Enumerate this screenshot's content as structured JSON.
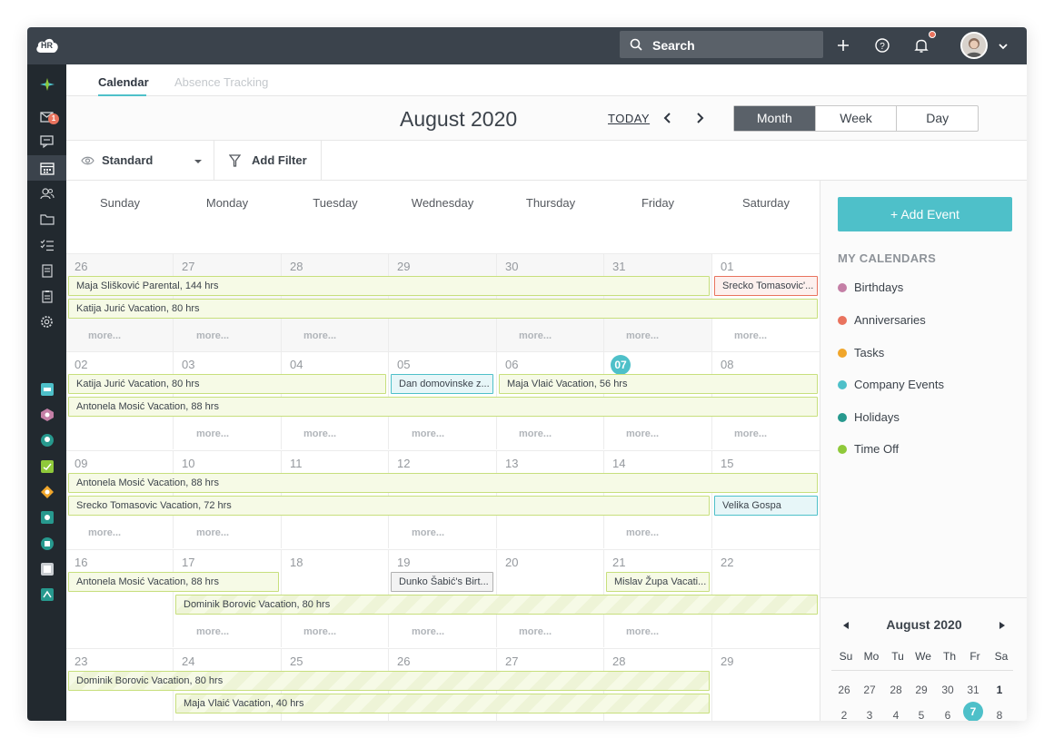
{
  "topbar": {
    "logo_text": "HR",
    "search_label": "Search",
    "notification_dot_color": "#e9735e"
  },
  "sidebar": {
    "inbox_badge": "1",
    "accent_color": "#4ec0c9"
  },
  "tabs": [
    {
      "label": "Calendar",
      "active": true
    },
    {
      "label": "Absence Tracking",
      "active": false
    }
  ],
  "header": {
    "month_title": "August 2020",
    "today_label": "TODAY",
    "views": [
      {
        "label": "Month",
        "active": true
      },
      {
        "label": "Week",
        "active": false
      },
      {
        "label": "Day",
        "active": false
      }
    ]
  },
  "filters": {
    "standard_label": "Standard",
    "add_filter_label": "Add Filter"
  },
  "calendar": {
    "day_names": [
      "Sunday",
      "Monday",
      "Tuesday",
      "Wednesday",
      "Thursday",
      "Friday",
      "Saturday"
    ],
    "more_label": "more...",
    "weeks": [
      {
        "days": [
          "26",
          "27",
          "28",
          "29",
          "30",
          "31",
          "01"
        ],
        "events": [
          {
            "label": "Maja Slišković Parental, 144 hrs",
            "type": "to"
          },
          {
            "label": "Srecko Tomasovic'...",
            "type": "an"
          },
          {
            "label": "Katija Jurić Vacation, 80 hrs",
            "type": "to"
          }
        ]
      },
      {
        "days": [
          "02",
          "03",
          "04",
          "05",
          "06",
          "07",
          "08"
        ],
        "events": [
          {
            "label": "Katija Jurić Vacation, 80 hrs",
            "type": "to"
          },
          {
            "label": "Dan domovinske z...",
            "type": "co"
          },
          {
            "label": "Maja Vlaić Vacation, 56 hrs",
            "type": "to"
          },
          {
            "label": "Antonela Mosić Vacation, 88 hrs",
            "type": "to"
          }
        ]
      },
      {
        "days": [
          "09",
          "10",
          "11",
          "12",
          "13",
          "14",
          "15"
        ],
        "events": [
          {
            "label": "Antonela Mosić Vacation, 88 hrs",
            "type": "to"
          },
          {
            "label": "Srecko Tomasovic Vacation, 72 hrs",
            "type": "to"
          },
          {
            "label": "Velika Gospa",
            "type": "co"
          }
        ]
      },
      {
        "days": [
          "16",
          "17",
          "18",
          "19",
          "20",
          "21",
          "22"
        ],
        "events": [
          {
            "label": "Antonela Mosić Vacation, 88 hrs",
            "type": "to"
          },
          {
            "label": "Dunko Šabić's Birt...",
            "type": "bd"
          },
          {
            "label": "Mislav Župa Vacati...",
            "type": "to"
          },
          {
            "label": "Dominik Borovic Vacation, 80 hrs",
            "type": "stripe"
          }
        ]
      },
      {
        "days": [
          "23",
          "24",
          "25",
          "26",
          "27",
          "28",
          "29"
        ],
        "events": [
          {
            "label": "Dominik Borovic Vacation, 80 hrs",
            "type": "stripe"
          },
          {
            "label": "Maja Vlaić Vacation, 40 hrs",
            "type": "stripe"
          }
        ]
      }
    ],
    "today_day": "07"
  },
  "right_panel": {
    "add_event_label": "+ Add Event",
    "my_calendars_title": "MY CALENDARS",
    "calendars": [
      {
        "label": "Birthdays",
        "color": "#c47fa6"
      },
      {
        "label": "Anniversaries",
        "color": "#e9735e"
      },
      {
        "label": "Tasks",
        "color": "#f0a62b"
      },
      {
        "label": "Company Events",
        "color": "#4ec0c9"
      },
      {
        "label": "Holidays",
        "color": "#27998e"
      },
      {
        "label": "Time Off",
        "color": "#8fc93a"
      }
    ],
    "mini_calendar": {
      "title": "August 2020",
      "weekday_headers": [
        "Su",
        "Mo",
        "Tu",
        "We",
        "Th",
        "Fr",
        "Sa"
      ],
      "first_row": [
        "26",
        "27",
        "28",
        "29",
        "30",
        "31",
        "1"
      ],
      "second_row": [
        "2",
        "3",
        "4",
        "5",
        "6",
        "7",
        "8"
      ],
      "today": "7"
    }
  }
}
